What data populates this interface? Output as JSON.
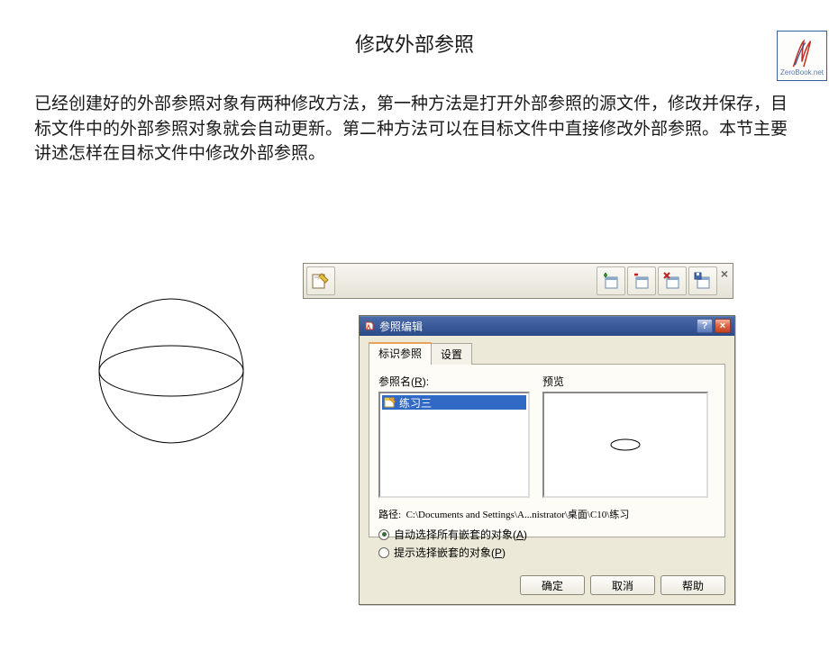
{
  "logo": {
    "text": "ZeroBook.net"
  },
  "page": {
    "title": "修改外部参照",
    "body": "已经创建好的外部参照对象有两种修改方法，第一种方法是打开外部参照的源文件，修改并保存，目标文件中的外部参照对象就会自动更新。第二种方法可以在目标文件中直接修改外部参照。本节主要讲述怎样在目标文件中修改外部参照。"
  },
  "toolbar": {
    "buttons": [
      "edit-block-in-place",
      "add-to-working-set",
      "remove-from-working-set",
      "discard-changes",
      "save-changes"
    ]
  },
  "dialog": {
    "title": "参照编辑",
    "tabs": {
      "identify": "标识参照",
      "settings": "设置"
    },
    "labels": {
      "refname_pre": "参照名",
      "refname_key": "R",
      "refname_post": ":",
      "preview": "预览"
    },
    "tree": {
      "item": "练习三"
    },
    "path": {
      "label": "路径:",
      "value": "C:\\Documents and Settings\\A...nistrator\\桌面\\C10\\练习"
    },
    "radios": {
      "auto_pre": "自动选择所有嵌套的对象(",
      "auto_key": "A",
      "auto_post": ")",
      "prompt_pre": "提示选择嵌套的对象(",
      "prompt_key": "P",
      "prompt_post": ")"
    },
    "buttons": {
      "ok": "确定",
      "cancel": "取消",
      "help": "帮助"
    }
  }
}
